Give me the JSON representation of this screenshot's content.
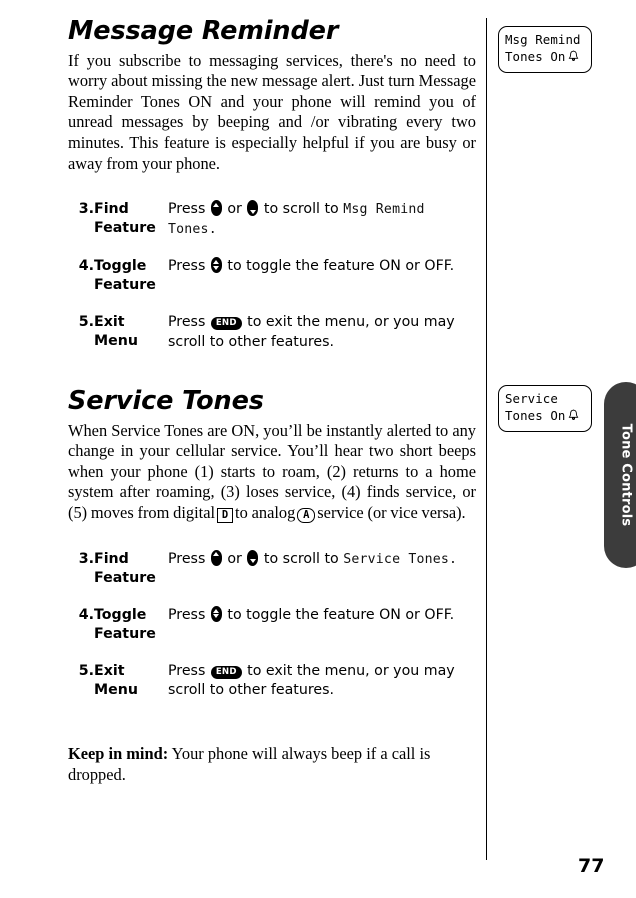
{
  "page": {
    "number": "77",
    "thumb_tab_label": "Tone Controls"
  },
  "sections": [
    {
      "title": "Message Reminder",
      "body": "If you subscribe to messaging services, there's no need to worry about missing the new message alert. Just turn Message Reminder Tones ON and your phone will remind you of unread messages by beeping and /or vibrating every two minutes. This feature is especially helpful if you are busy or away from your phone.",
      "steps": [
        {
          "number": "3.",
          "label_line1": "Find",
          "label_line2": "Feature",
          "text_before": "Press",
          "text_mid": "or",
          "text_after": "to scroll to",
          "lcd_value": "Msg Remind Tones.",
          "keys": [
            "up-key",
            "down-key"
          ]
        },
        {
          "number": "4.",
          "label_line1": "Toggle",
          "label_line2": "Feature",
          "text_before": "Press",
          "text_after": "to toggle the feature ON or OFF.",
          "keys": [
            "up-down-key"
          ]
        },
        {
          "number": "5.",
          "label_line1": "Exit",
          "label_line2": "Menu",
          "text_before": "Press",
          "text_after": "to exit the menu, or you may scroll to other features.",
          "keys": [
            "end-key"
          ]
        }
      ]
    },
    {
      "title": "Service Tones",
      "body_part1": "When Service Tones are ON, you’ll be instantly alerted to any change in your cellular service. You’ll hear two short beeps when your phone (1) starts to roam, (2) returns to a home system after roaming, (3) loses service, (4) finds service, or (5) moves from digital",
      "digital_indicator": "D",
      "body_part2": "to analog",
      "analog_indicator": "A",
      "body_part3": "service (or vice versa).",
      "steps": [
        {
          "number": "3.",
          "label_line1": "Find",
          "label_line2": "Feature",
          "text_before": "Press",
          "text_mid": "or",
          "text_after": "to scroll to",
          "lcd_value": "Service Tones.",
          "keys": [
            "up-key",
            "down-key"
          ]
        },
        {
          "number": "4.",
          "label_line1": "Toggle",
          "label_line2": "Feature",
          "text_before": "Press",
          "text_after": "to toggle the feature ON or OFF.",
          "keys": [
            "up-down-key"
          ]
        },
        {
          "number": "5.",
          "label_line1": "Exit",
          "label_line2": "Menu",
          "text_before": "Press",
          "text_after": "to exit the menu, or you may scroll to other features.",
          "keys": [
            "end-key"
          ]
        }
      ]
    }
  ],
  "note": {
    "lead": "Keep in mind:",
    "text": " Your phone will always beep if a call is dropped."
  },
  "callouts": [
    {
      "id": "msg",
      "line1": "Msg Remind",
      "line2": "Tones On",
      "icon": "bell-icon",
      "icon_glyph": "♩"
    },
    {
      "id": "service",
      "line1": "Service",
      "line2": "Tones On",
      "icon": "bell-icon",
      "icon_glyph": "♩"
    }
  ],
  "keys": {
    "end_label": "END"
  },
  "colors": {
    "ink": "#000000",
    "tab_background": "#3c3c3c",
    "tab_text": "#ffffff",
    "paper": "#ffffff"
  }
}
